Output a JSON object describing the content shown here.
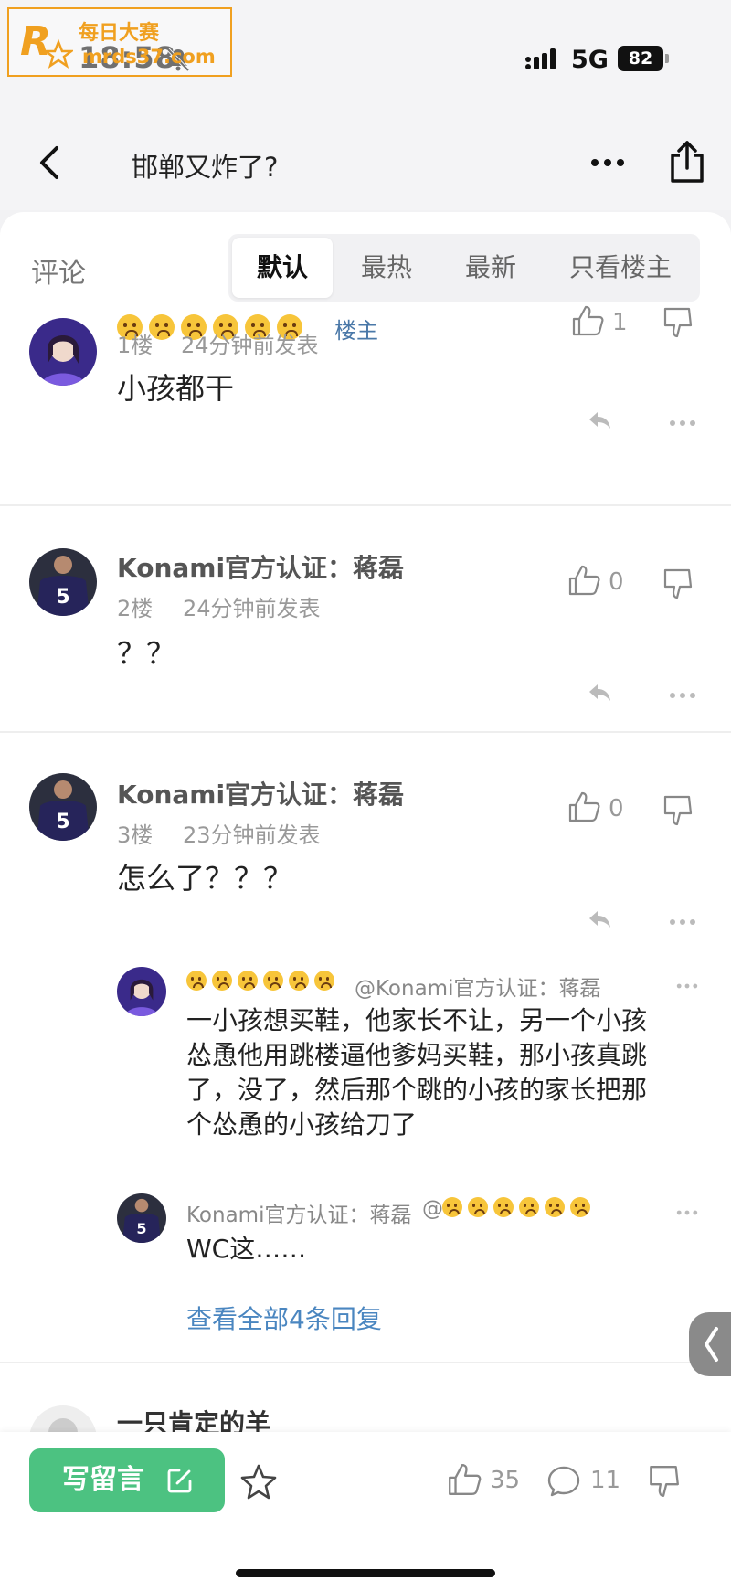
{
  "status_bar": {
    "time": "18:58",
    "network": "5G",
    "battery": "82",
    "watermark_title": "每日大赛",
    "watermark_url": "mrds37.com"
  },
  "header": {
    "title": "邯郸又炸了?"
  },
  "tabs": {
    "label": "评论",
    "items": [
      "默认",
      "最热",
      "最新",
      "只看楼主"
    ],
    "active": "默认"
  },
  "comments": [
    {
      "name": "",
      "badge": "楼主",
      "floor": "1楼",
      "time": "24分钟前发表",
      "text": "小孩都干",
      "likes": "1"
    },
    {
      "name": "Konami官方认证：蒋磊",
      "floor": "2楼",
      "time": "24分钟前发表",
      "text": "？？",
      "likes": "0"
    },
    {
      "name": "Konami官方认证：蒋磊",
      "floor": "3楼",
      "time": "23分钟前发表",
      "text": "怎么了？？？",
      "likes": "0"
    }
  ],
  "replies": [
    {
      "mention": "@Konami官方认证：蒋磊",
      "lines": [
        "一小孩想买鞋，他家长不让，另一个小孩",
        "怂恿他用跳楼逼他爹妈买鞋，那小孩真跳",
        "了，没了，然后那个跳的小孩的家长把那",
        "个怂恿的小孩给刀了"
      ]
    },
    {
      "name": "Konami官方认证：蒋磊",
      "mention_prefix": "@",
      "lines": [
        "WC这……"
      ]
    }
  ],
  "view_all_replies": "查看全部4条回复",
  "partial_comment_name": "一只肯定的羊",
  "bottom_bar": {
    "write_label": "写留言",
    "likes": "35",
    "comments": "11"
  },
  "colors": {
    "accent_green": "#4cc281",
    "link_blue": "#4a86c0",
    "owner_blue": "#4a78a8"
  }
}
